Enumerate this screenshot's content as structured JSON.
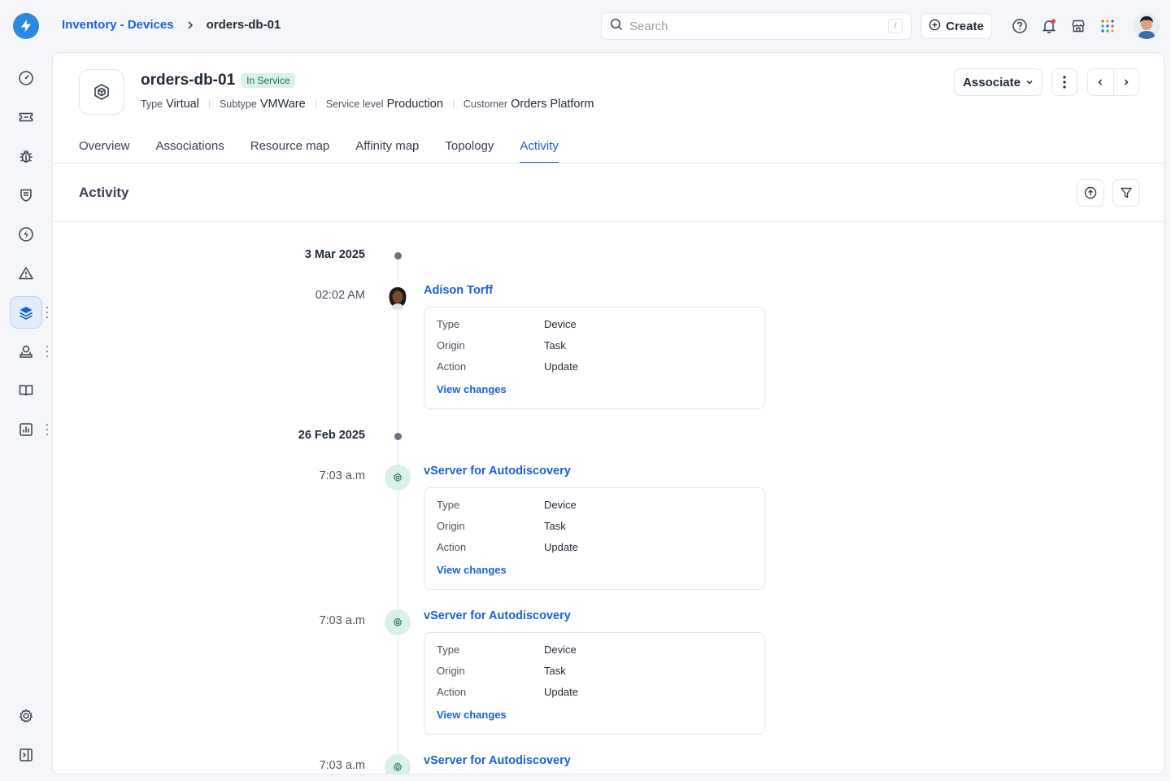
{
  "breadcrumb": {
    "parent": "Inventory - Devices",
    "current": "orders-db-01"
  },
  "search": {
    "placeholder": "Search",
    "shortcut": "/"
  },
  "header_actions": {
    "create_label": "Create"
  },
  "device": {
    "name": "orders-db-01",
    "status": "In Service",
    "meta": [
      {
        "label": "Type",
        "value": "Virtual"
      },
      {
        "label": "Subtype",
        "value": "VMWare"
      },
      {
        "label": "Service level",
        "value": "Production"
      },
      {
        "label": "Customer",
        "value": "Orders Platform"
      }
    ],
    "associate_label": "Associate"
  },
  "tabs": [
    "Overview",
    "Associations",
    "Resource map",
    "Affinity map",
    "Topology",
    "Activity"
  ],
  "active_tab": "Activity",
  "section": {
    "title": "Activity"
  },
  "timeline": {
    "dates": [
      "3 Mar 2025",
      "26 Feb 2025"
    ],
    "entries": [
      {
        "time": "02:02 AM",
        "actor": "Adison Torff",
        "type_label": "Type",
        "type": "Device",
        "origin_label": "Origin",
        "origin": "Task",
        "action_label": "Action",
        "action": "Update",
        "link": "View changes"
      },
      {
        "time": "7:03 a.m",
        "actor": "vServer for Autodiscovery",
        "type_label": "Type",
        "type": "Device",
        "origin_label": "Origin",
        "origin": "Task",
        "action_label": "Action",
        "action": "Update",
        "link": "View changes"
      },
      {
        "time": "7:03 a.m",
        "actor": "vServer for Autodiscovery",
        "type_label": "Type",
        "type": "Device",
        "origin_label": "Origin",
        "origin": "Task",
        "action_label": "Action",
        "action": "Update",
        "link": "View changes"
      },
      {
        "time": "7:03 a.m",
        "actor": "vServer for Autodiscovery"
      }
    ]
  },
  "colors": {
    "accent": "#1d5fd8",
    "logo": "#2a8ae0",
    "status_bg": "#d9f1ea",
    "status_text": "#1f6f55"
  }
}
